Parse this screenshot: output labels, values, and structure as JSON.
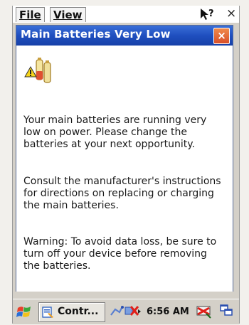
{
  "menubar": {
    "file_label": "File",
    "view_label": "View",
    "help_icon": "help-question-icon",
    "close_label": "×"
  },
  "dialog": {
    "title": "Main Batteries Very Low",
    "close_label": "×",
    "icon": "battery-warning-icon",
    "paragraphs": [
      "Your main batteries are running very low on power. Please change the batteries at your next opportunity.",
      "Consult the manufacturer's instructions for directions on replacing or charging the main batteries.",
      "Warning: To avoid data loss, be sure to turn off your device before removing the batteries."
    ]
  },
  "taskbar": {
    "start_icon": "windows-flag-icon",
    "task_label": "Contr...",
    "clock": "6:56 AM",
    "tray_icons": [
      "connectivity-icon",
      "network-disconnected-icon",
      "battery-low-icon",
      "desktop-icon"
    ]
  },
  "colors": {
    "title_bar": "#1f4fbf",
    "close_button": "#e06a35",
    "screen_bg": "#d4d0c8"
  }
}
